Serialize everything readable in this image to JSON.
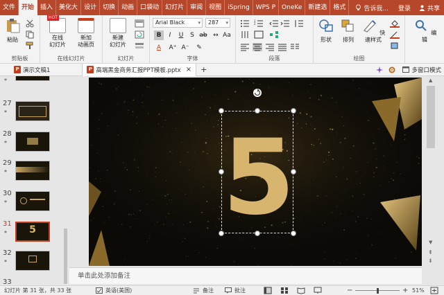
{
  "menu": {
    "tabs": [
      "文件",
      "开始",
      "插入",
      "美化大",
      "设计",
      "切换",
      "动画",
      "口袋动",
      "幻灯片",
      "审阅",
      "视图",
      "iSpring",
      "WPS P",
      "OneKe",
      "新建选",
      "格式"
    ],
    "active_index": 1,
    "tell_me": "告诉我...",
    "login": "登录",
    "share": "共享"
  },
  "ribbon": {
    "paste": "粘贴",
    "clipboard": "剪贴板",
    "online_slide": "在线\n幻灯片",
    "new_online_page": "新加\n动画页",
    "online_group": "在线幻灯片",
    "new_slide": "新建\n幻灯片",
    "slides_group": "幻灯片",
    "font_name": "Arial Black",
    "font_size": "287",
    "font_group": "字体",
    "para_group": "段落",
    "shape": "形状",
    "arrange": "排列",
    "quick_style": "快速样式",
    "draw_group": "绘图",
    "edit": "编辑",
    "hot_badge": "HOT"
  },
  "doctabs": {
    "tab1": "演示文稿1",
    "tab2": "高端黑金商务汇报PPT模板.pptx",
    "close": "×",
    "add": "+",
    "multiwindow": "多窗口模式"
  },
  "thumbs": [
    {
      "num": "",
      "star": "*"
    },
    {
      "num": "27",
      "star": "*"
    },
    {
      "num": "28",
      "star": "*"
    },
    {
      "num": "29",
      "star": "*"
    },
    {
      "num": "30",
      "star": "*"
    },
    {
      "num": "31",
      "star": "*",
      "selected": true
    },
    {
      "num": "32",
      "star": "*"
    },
    {
      "num": "33",
      "star": "*"
    }
  ],
  "slide": {
    "number": "5"
  },
  "notes_placeholder": "单击此处添加备注",
  "status": {
    "slide_info": "幻灯片 第 31 张，共 33 张",
    "language": "英语(美国)",
    "notes": "备注",
    "comments": "批注",
    "zoom": "51%"
  },
  "colors": {
    "accent": "#b7472a",
    "gold": "#d7b56e"
  }
}
